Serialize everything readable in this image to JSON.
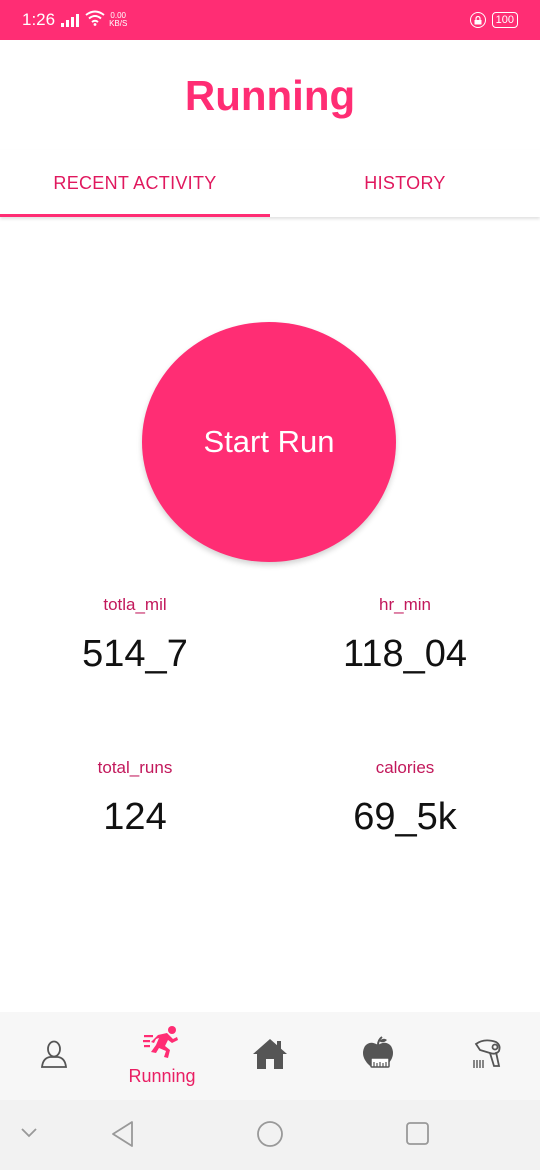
{
  "status_bar": {
    "time": "1:26",
    "net_speed_value": "0.00",
    "net_speed_unit": "KB/S",
    "battery": "100"
  },
  "app": {
    "title": "Running"
  },
  "tabs": [
    {
      "label": "RECENT ACTIVITY",
      "active": true
    },
    {
      "label": "HISTORY",
      "active": false
    }
  ],
  "start_button": {
    "label": "Start Run"
  },
  "stats": {
    "total_miles": {
      "label": "totla_mil",
      "value": "514_7"
    },
    "hr_min": {
      "label": "hr_min",
      "value": "118_04"
    },
    "total_runs": {
      "label": "total_runs",
      "value": "124"
    },
    "calories": {
      "label": "calories",
      "value": "69_5k"
    }
  },
  "bottom_nav": {
    "items": [
      {
        "icon": "profile-icon",
        "label": ""
      },
      {
        "icon": "running-icon",
        "label": "Running",
        "active": true
      },
      {
        "icon": "home-icon",
        "label": ""
      },
      {
        "icon": "nutrition-icon",
        "label": ""
      },
      {
        "icon": "hair-dryer-icon",
        "label": ""
      }
    ]
  },
  "colors": {
    "accent": "#ff2d74",
    "label": "#c2185b",
    "icon_grey": "#555555"
  }
}
